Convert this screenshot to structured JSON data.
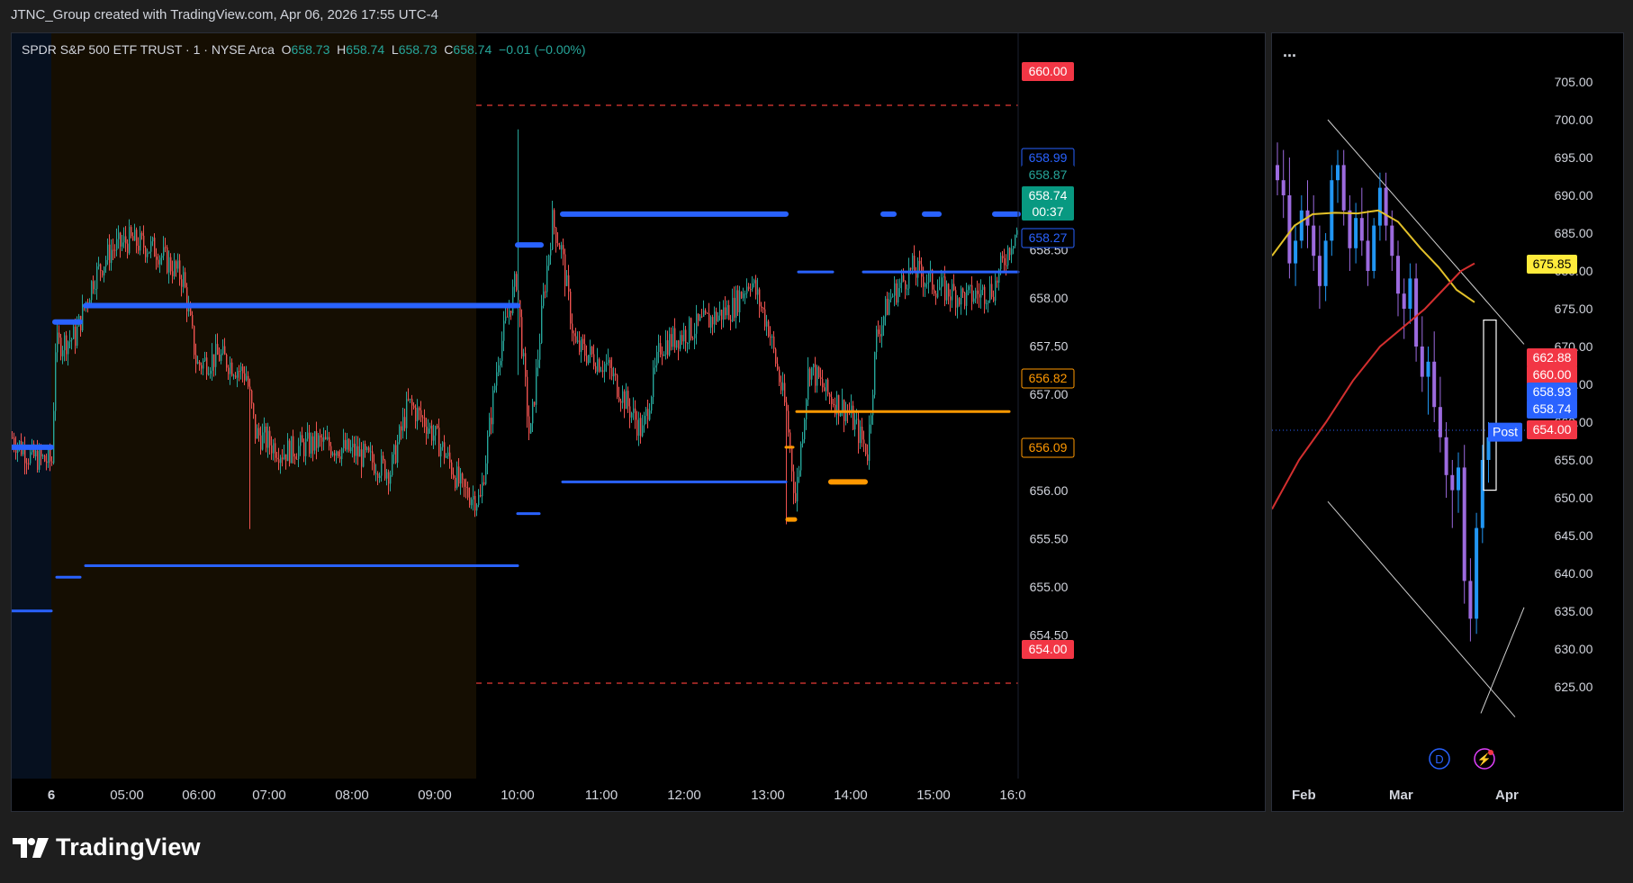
{
  "header": {
    "attribution": "JTNC_Group created with TradingView.com, Apr 06, 2026 17:55 UTC-4"
  },
  "legend": {
    "symbol": "SPDR S&P 500 ETF TRUST · 1 · NYSE Arca",
    "o_label": "O",
    "o_value": "658.73",
    "h_label": "H",
    "h_value": "658.74",
    "l_label": "L",
    "l_value": "658.73",
    "c_label": "C",
    "c_value": "658.74",
    "change": "−0.01 (−0.00%)"
  },
  "right_panel": {
    "menu": "..."
  },
  "branding": {
    "name": "TradingView"
  },
  "colors": {
    "up": "#26a69a",
    "down": "#ef5350",
    "level_blue": "#2962ff",
    "level_orange": "#ff9800",
    "sma_yellow": "#e2c029",
    "sma_red": "#d32f2f"
  },
  "chart_data": [
    {
      "type": "candlestick",
      "interval": "1 minute",
      "yaxis_ticks": [
        "659.50",
        "659.00",
        "658.50",
        "658.00",
        "657.50",
        "657.00",
        "656.50",
        "656.00",
        "655.50",
        "655.00",
        "654.50"
      ],
      "ylim": [
        654.0,
        660.4
      ],
      "xaxis_ticks": [
        "6",
        "05:00",
        "06:00",
        "07:00",
        "08:00",
        "09:00",
        "10:00",
        "11:00",
        "12:00",
        "13:00",
        "14:00",
        "15:00",
        "16:0"
      ],
      "price_labels": [
        {
          "value": 660.0,
          "text": "660.00",
          "color": "#f23645",
          "style": "filled"
        },
        {
          "value": 658.99,
          "text": "658.99",
          "color": "#2962ff",
          "style": "outline"
        },
        {
          "value": 658.87,
          "text": "658.87",
          "color": "#26a69a",
          "style": "plain"
        },
        {
          "value": 658.74,
          "text": "658.74",
          "color": "#089981",
          "style": "filled"
        },
        {
          "value": 658.27,
          "text": "658.27",
          "color": "#2962ff",
          "style": "outline"
        },
        {
          "value": 656.82,
          "text": "656.82",
          "color": "#ff9800",
          "style": "outline"
        },
        {
          "value": 656.09,
          "text": "656.09",
          "color": "#ff9800",
          "style": "outline"
        },
        {
          "value": 654.0,
          "text": "654.00",
          "color": "#f23645",
          "style": "filled"
        }
      ],
      "countdown": "00:37",
      "dashed_levels": [
        660.0,
        654.0
      ],
      "key_levels": [
        658.87,
        658.27,
        657.92,
        656.82,
        656.09,
        655.22
      ]
    },
    {
      "type": "candlestick",
      "interval": "1 day",
      "yaxis_ticks": [
        "705.00",
        "700.00",
        "695.00",
        "690.00",
        "685.00",
        "680.00",
        "675.00",
        "670.00",
        "665.00",
        "660.00",
        "655.00",
        "650.00",
        "645.00",
        "640.00",
        "635.00",
        "630.00",
        "625.00"
      ],
      "ylim": [
        620,
        707
      ],
      "xaxis_ticks": [
        "Feb",
        "Mar",
        "Apr"
      ],
      "price_labels": [
        {
          "value": 675.85,
          "text": "675.85",
          "color": "#ffeb3b",
          "style": "filled"
        },
        {
          "value": 662.88,
          "text": "662.88",
          "color": "#f23645",
          "style": "filled"
        },
        {
          "value": 660.0,
          "text": "660.00",
          "color": "#f23645",
          "style": "filled"
        },
        {
          "value": 658.93,
          "text": "658.93",
          "color": "#2962ff",
          "style": "filled"
        },
        {
          "value": 658.74,
          "text": "658.74",
          "color": "#2962ff",
          "style": "filled"
        },
        {
          "value": 654.0,
          "text": "654.00",
          "color": "#f23645",
          "style": "filled"
        }
      ],
      "post_label": "Post",
      "event_icons": [
        "D",
        "⚡"
      ],
      "moving_averages": [
        {
          "color": "#e2c029",
          "last": 675.85
        },
        {
          "color": "#d32f2f",
          "last": 662.88
        }
      ]
    }
  ]
}
